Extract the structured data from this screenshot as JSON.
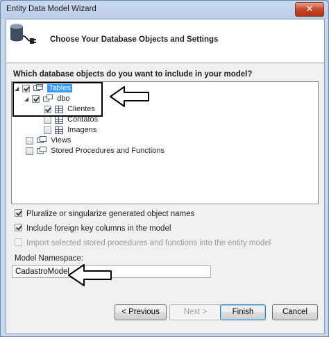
{
  "window": {
    "title": "Entity Data Model Wizard",
    "close_label": "✕"
  },
  "header": {
    "title": "Choose Your Database Objects and Settings",
    "icon": "database-plug-icon"
  },
  "question": "Which database objects do you want to include in your model?",
  "tree": {
    "tables": {
      "label": "Tables",
      "checked": true
    },
    "dbo": {
      "label": "dbo",
      "checked": true
    },
    "items": [
      {
        "label": "Clientes",
        "checked": true
      },
      {
        "label": "Contatos",
        "checked": false
      },
      {
        "label": "Imagens",
        "checked": false
      }
    ],
    "views": {
      "label": "Views",
      "checked": false
    },
    "procs": {
      "label": "Stored Procedures and Functions",
      "checked": false
    }
  },
  "options": {
    "pluralize": "Pluralize or singularize generated object names",
    "foreign_keys": "Include foreign key columns in the model",
    "import_procs": "Import selected stored procedures and functions into the entity model"
  },
  "namespace": {
    "label": "Model Namespace:",
    "value": "CadastroModel"
  },
  "buttons": {
    "previous": "< Previous",
    "next": "Next >",
    "finish": "Finish",
    "cancel": "Cancel"
  }
}
